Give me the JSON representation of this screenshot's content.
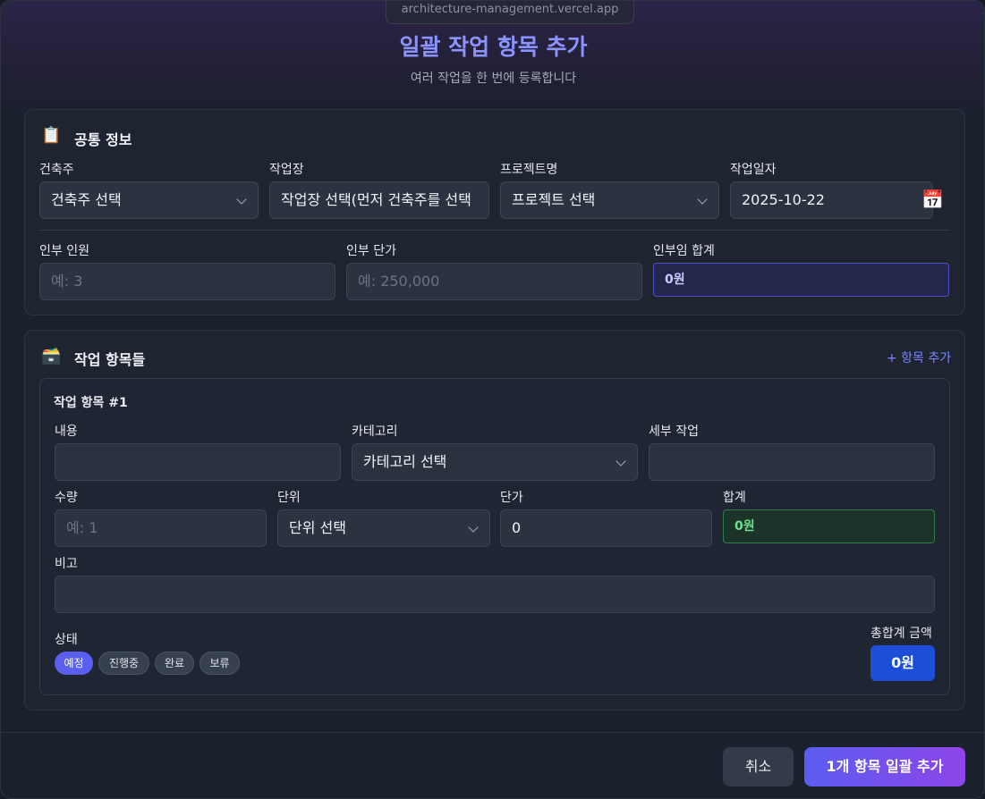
{
  "header": {
    "url": "architecture-management.vercel.app",
    "title": "일괄 작업 항목 추가",
    "subtitle": "여러 작업을 한 번에 등록합니다"
  },
  "common": {
    "icon": "clipboard-icon",
    "title": "공통 정보",
    "builder": {
      "label": "건축주",
      "value": "건축주 선택"
    },
    "site": {
      "label": "작업장",
      "value": "작업장 선택(먼저 건축주를 선택"
    },
    "project": {
      "label": "프로젝트명",
      "value": "프로젝트 선택"
    },
    "work_date": {
      "label": "작업일자",
      "value": "2025-10-22"
    },
    "labor_count": {
      "label": "인부 인원",
      "placeholder": "예: 3"
    },
    "labor_rate": {
      "label": "인부 단가",
      "placeholder": "예: 250,000"
    },
    "labor_total": {
      "label": "인부임 합계",
      "value": "0원"
    }
  },
  "items": {
    "icon": "box-icon",
    "title": "작업 항목들",
    "add_label": "+ 항목 추가",
    "list": [
      {
        "heading": "작업 항목 #1",
        "content": {
          "label": "내용",
          "value": ""
        },
        "category": {
          "label": "카테고리",
          "value": "카테고리 선택"
        },
        "detail": {
          "label": "세부 작업",
          "value": ""
        },
        "quantity": {
          "label": "수량",
          "placeholder": "예: 1"
        },
        "unit": {
          "label": "단위",
          "value": "단위 선택"
        },
        "unit_price": {
          "label": "단가",
          "value": "0"
        },
        "subtotal": {
          "label": "합계",
          "value": "0원"
        },
        "note": {
          "label": "비고",
          "value": ""
        },
        "status": {
          "label": "상태",
          "options": [
            "예정",
            "진행중",
            "완료",
            "보류"
          ],
          "selected": "예정"
        },
        "grand_total": {
          "label": "총합계 금액",
          "value": "0원"
        }
      }
    ]
  },
  "footer": {
    "cancel_label": "취소",
    "submit_label": "1개 항목 일괄 추가"
  },
  "colors": {
    "accent": "#5a5ff0",
    "title": "#8b93ff",
    "total_blue": "#1d4ed8",
    "sum_green": "#6fe08d"
  }
}
